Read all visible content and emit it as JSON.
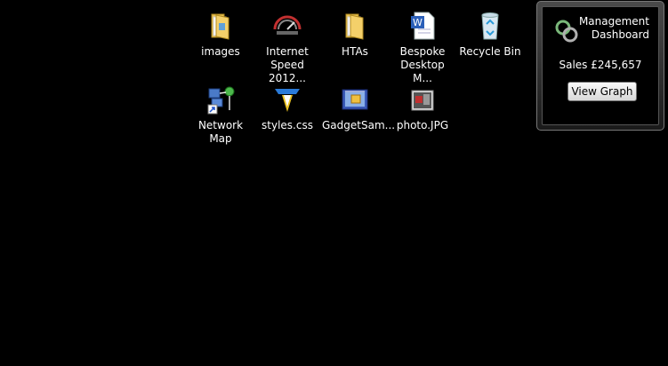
{
  "desktop": {
    "icons": [
      {
        "label": "images",
        "icon": "folder-icon"
      },
      {
        "label": "Internet Speed 2012...",
        "icon": "network-speed-icon"
      },
      {
        "label": "HTAs",
        "icon": "folder-icon"
      },
      {
        "label": "Bespoke Desktop M...",
        "icon": "word-document-icon"
      },
      {
        "label": "Recycle Bin",
        "icon": "recycle-bin-icon"
      },
      {
        "label": "Network Map",
        "icon": "network-map-shortcut-icon"
      },
      {
        "label": "styles.css",
        "icon": "css-file-icon"
      },
      {
        "label": "GadgetSam...",
        "icon": "gadget-folder-icon"
      },
      {
        "label": "photo.JPG",
        "icon": "photo-file-icon"
      }
    ]
  },
  "gadget": {
    "title_line1": "Management",
    "title_line2": "Dashboard",
    "sales_text": "Sales £245,657",
    "button_label": "View Graph"
  }
}
